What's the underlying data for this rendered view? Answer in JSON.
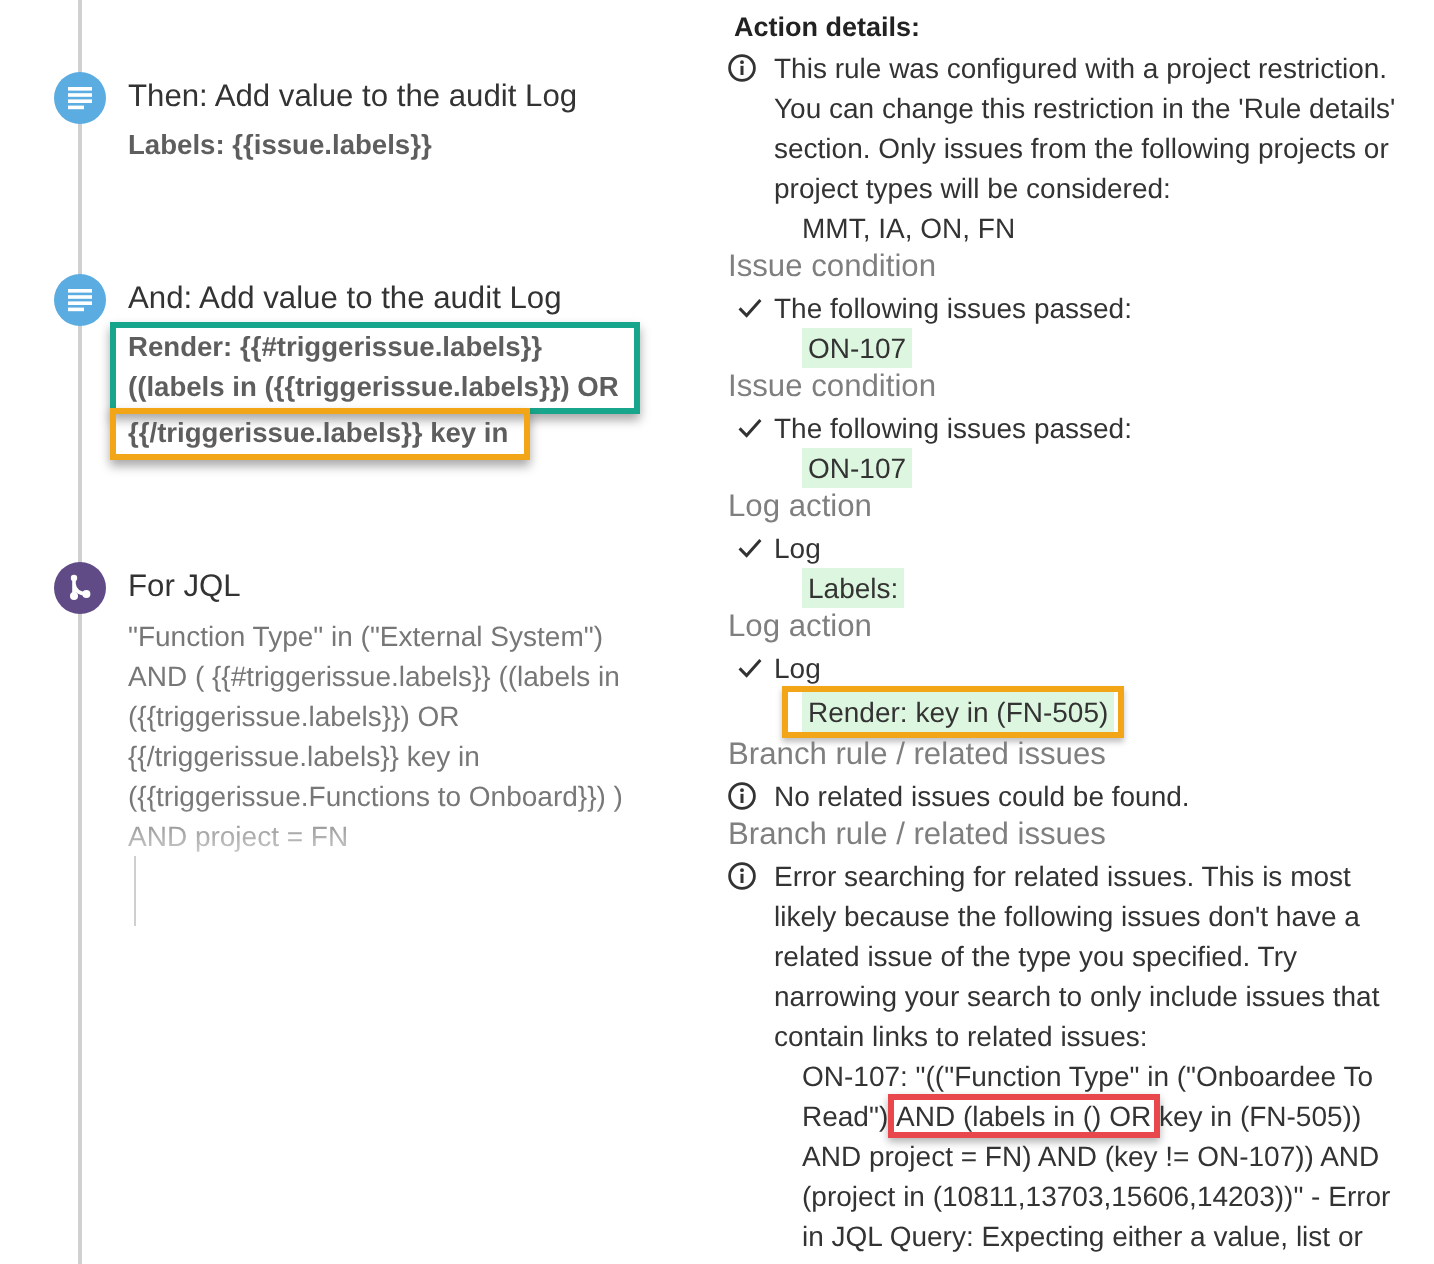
{
  "timeline": {
    "steps": [
      {
        "kind": "action",
        "title": "Then: Add value to the audit Log",
        "groups": [
          {
            "lines": [
              "Labels: {{issue.labels}}"
            ]
          }
        ]
      },
      {
        "kind": "action",
        "title": "And: Add value to the audit Log",
        "groups": [
          {
            "color": "#17a58b",
            "lines": [
              "Render: {{#triggerissue.labels}}",
              "((labels in ({{triggerissue.labels}}) OR"
            ]
          },
          {
            "color": "#f2a516",
            "lines": [
              "{{/triggerissue.labels}} key in"
            ]
          }
        ]
      },
      {
        "kind": "branch",
        "title": "For JQL",
        "text": "\"Function Type\" in (\"External System\")\nAND ( {{#triggerissue.labels}} ((labels in\n({{triggerissue.labels}}) OR\n{{/triggerissue.labels}} key in\n({{triggerissue.Functions to Onboard}}) )\nAND project = FN"
      }
    ]
  },
  "action_details": {
    "heading": "Action details:",
    "entries": [
      {
        "kind": "info",
        "text": "This rule was configured with a project restriction. You can change this restriction in the 'Rule details' section. Only issues from the following projects or project types will be considered:",
        "items": [
          {
            "text": "MMT, IA, ON, FN",
            "highlighted": false
          }
        ]
      },
      {
        "kind": "heading",
        "text": "Issue condition"
      },
      {
        "kind": "check",
        "text": "The following issues passed:",
        "items": [
          {
            "text": "ON-107",
            "highlighted": true
          }
        ]
      },
      {
        "kind": "heading",
        "text": "Issue condition"
      },
      {
        "kind": "check",
        "text": "The following issues passed:",
        "items": [
          {
            "text": "ON-107",
            "highlighted": true
          }
        ]
      },
      {
        "kind": "heading",
        "text": "Log action"
      },
      {
        "kind": "check",
        "text": "Log",
        "items": [
          {
            "text": "Labels:",
            "highlighted": true
          }
        ]
      },
      {
        "kind": "heading",
        "text": "Log action"
      },
      {
        "kind": "check",
        "text": "Log",
        "items": [
          {
            "text": "Render: key in (FN-505)",
            "highlighted": true,
            "color": "#f2a516"
          }
        ]
      },
      {
        "kind": "heading",
        "text": "Branch rule / related issues"
      },
      {
        "kind": "info",
        "text": "No related issues could be found."
      },
      {
        "kind": "heading",
        "text": "Branch rule / related issues"
      },
      {
        "kind": "info",
        "text": "Error searching for related issues. This is most likely because the following issues don't have a related issue of the type you specified. Try narrowing your search to only include issues that contain links to related issues:",
        "lines": [
          {
            "parts": [
              {
                "text": "ON-107: \"((\"Function Type\" in (\"Onboardee To"
              }
            ]
          },
          {
            "parts": [
              {
                "text": "Read\")"
              },
              {
                "text": "AND (labels in () OR",
                "color": "#e8474c"
              },
              {
                "text": "key in (FN-505))"
              }
            ]
          },
          {
            "parts": [
              {
                "text": "AND project = FN) AND (key != ON-107)) AND"
              }
            ]
          },
          {
            "parts": [
              {
                "text": "(project in (10811,13703,15606,14203))\" - Error"
              }
            ]
          },
          {
            "parts": [
              {
                "text": "in JQL Query: Expecting either a value, list or"
              }
            ]
          }
        ]
      }
    ]
  }
}
